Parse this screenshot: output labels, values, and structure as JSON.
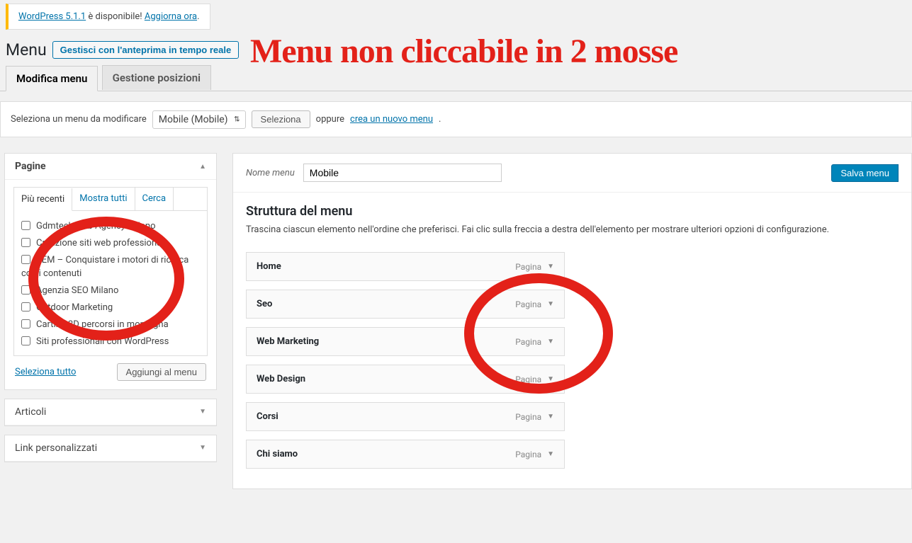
{
  "update_nag": {
    "prefix_link": "WordPress 5.1.1",
    "text": " è disponibile! ",
    "action_link": "Aggiorna ora"
  },
  "heading": "Menu",
  "preview_button": "Gestisci con l'anteprima in tempo reale",
  "overlay_title": "Menu non cliccabile in 2 mosse",
  "tabs": {
    "edit": "Modifica menu",
    "locations": "Gestione posizioni"
  },
  "select_bar": {
    "label": "Seleziona un menu da modificare",
    "selected": "Mobile (Mobile)",
    "button": "Seleziona",
    "or": "oppure ",
    "create_link": "crea un nuovo menu",
    "dot": "."
  },
  "sidebar": {
    "pages": {
      "title": "Pagine",
      "subtabs": {
        "recent": "Più recenti",
        "all": "Mostra tutti",
        "search": "Cerca"
      },
      "items": [
        "Gdmtech web Agency Milano",
        "Creazione siti web professionali.",
        "SEM – Conquistare i motori di ricerca con i contenuti",
        "Agenzia SEO Milano",
        "Outdoor Marketing",
        "Cartine 3D percorsi in montagna",
        "Siti professionali con WordPress"
      ],
      "select_all": "Seleziona tutto",
      "add_button": "Aggiungi al menu"
    },
    "posts": {
      "title": "Articoli"
    },
    "links": {
      "title": "Link personalizzati"
    }
  },
  "main": {
    "name_label": "Nome menu",
    "name_value": "Mobile",
    "save_button": "Salva menu",
    "structure_title": "Struttura del menu",
    "structure_desc": "Trascina ciascun elemento nell'ordine che preferisci. Fai clic sulla freccia a destra dell'elemento per mostrare ulteriori opzioni di configurazione.",
    "type_label": "Pagina",
    "items": [
      {
        "title": "Home"
      },
      {
        "title": "Seo"
      },
      {
        "title": "Web Marketing"
      },
      {
        "title": "Web Design"
      },
      {
        "title": "Corsi"
      },
      {
        "title": "Chi siamo"
      }
    ]
  }
}
